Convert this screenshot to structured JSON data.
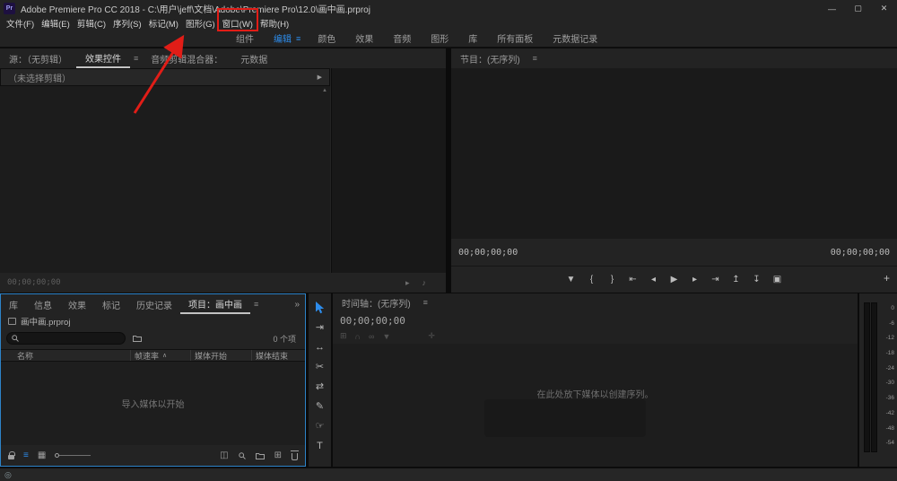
{
  "colors": {
    "accent_blue": "#2D8CEB",
    "annotation_red": "#E11D17",
    "panel_bg": "#232323"
  },
  "titlebar": {
    "logo": "Pr",
    "title": "Adobe Premiere Pro CC 2018 - C:\\用户\\jeff\\文档\\Adobe\\Premiere Pro\\12.0\\画中画.prproj",
    "minimize": "—",
    "maximize": "▢",
    "close": "✕"
  },
  "menubar": {
    "items": [
      {
        "label": "文件(F)"
      },
      {
        "label": "编辑(E)"
      },
      {
        "label": "剪辑(C)"
      },
      {
        "label": "序列(S)"
      },
      {
        "label": "标记(M)"
      },
      {
        "label": "图形(G)"
      },
      {
        "label": "窗口(W)"
      },
      {
        "label": "帮助(H)"
      }
    ]
  },
  "workspace": {
    "tabs": [
      {
        "label": "组件"
      },
      {
        "label": "编辑"
      },
      {
        "label": "颜色"
      },
      {
        "label": "效果"
      },
      {
        "label": "音频"
      },
      {
        "label": "图形"
      },
      {
        "label": "库"
      },
      {
        "label": "所有面板"
      },
      {
        "label": "元数据记录"
      }
    ],
    "active_tab_menu_icon": "≡"
  },
  "source_panel": {
    "tabs": [
      {
        "label": "源：（无剪辑）"
      },
      {
        "label": "效果控件"
      },
      {
        "label": "音频剪辑混合器："
      },
      {
        "label": "元数据"
      }
    ],
    "panel_menu_icon": "≡",
    "clip_selector": "（未选择剪辑）",
    "selector_arrow": "▶",
    "scroll_up_arrow": "▲",
    "timecode": "00;00;00;00",
    "play_video_icon": "▸",
    "play_audio_icon": "♪"
  },
  "program_panel": {
    "title": "节目：(无序列)",
    "panel_menu_icon": "≡",
    "position_timecode": "00;00;00;00",
    "duration_timecode": "00;00;00;00",
    "transport": {
      "add_marker": "▼",
      "mark_in": "{",
      "mark_out": "}",
      "go_to_in": "⇤",
      "step_back": "◂",
      "play": "▶",
      "step_forward": "▸",
      "go_to_out": "⇥",
      "lift": "↥",
      "extract": "↧",
      "export_frame": "▣",
      "button_editor": "+"
    }
  },
  "project_panel": {
    "tabs": [
      {
        "label": "库"
      },
      {
        "label": "信息"
      },
      {
        "label": "效果"
      },
      {
        "label": "标记"
      },
      {
        "label": "历史记录"
      },
      {
        "label": "项目：画中画"
      }
    ],
    "panel_menu_icon": "≡",
    "overflow_icon": "»",
    "project_file": "画中画.prproj",
    "item_count": "0 个项",
    "columns": {
      "name": "名称",
      "frame_rate": "帧速率",
      "sort_icon": "∧",
      "media_start": "媒体开始",
      "media_end": "媒体结束"
    },
    "empty_text": "导入媒体以开始",
    "footer": {
      "list_view_icon": "≡",
      "icon_view_icon": "▦",
      "automate_icon": "◫",
      "new_item_icon": "⊞"
    }
  },
  "tools_panel": {
    "track_select_icon": "⇥",
    "ripple_edit_icon": "↔",
    "razor_icon": "✂",
    "slip_icon": "⇄",
    "pen_icon": "✎",
    "hand_icon": "☞",
    "type_icon": "T"
  },
  "timeline_panel": {
    "title": "时间轴：(无序列)",
    "panel_menu_icon": "≡",
    "timecode": "00;00;00;00",
    "toolbar": {
      "nest_icon": "⊞",
      "snap_icon": "∩",
      "linked_selection_icon": "∞",
      "add_marker_icon": "▼",
      "settings_icon": "✛"
    },
    "empty_text": "在此处放下媒体以创建序列。"
  },
  "audio_meter": {
    "labels": [
      "0",
      "-6",
      "-12",
      "-18",
      "-24",
      "-30",
      "-36",
      "-42",
      "-48",
      "-54"
    ]
  },
  "statusbar": {
    "status_icon": "◎"
  }
}
